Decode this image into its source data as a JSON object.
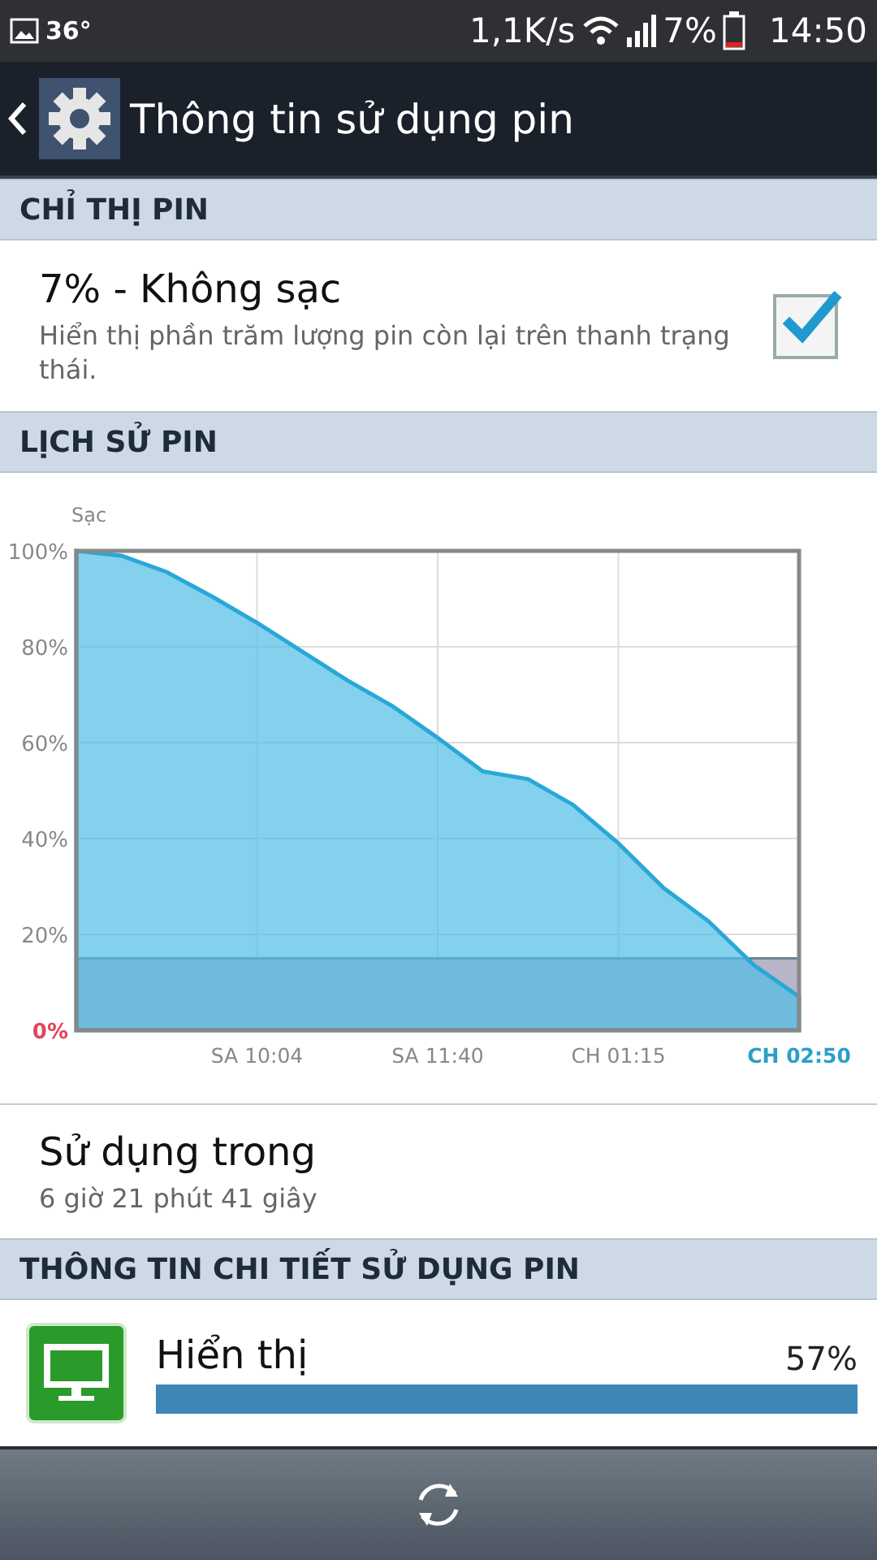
{
  "status_bar": {
    "temperature": "36°",
    "speed": "1,1K/s",
    "battery": "7%",
    "time": "14:50"
  },
  "action_bar": {
    "title": "Thông tin sử dụng pin"
  },
  "sections": [
    {
      "kind": "checkbox",
      "header": "CHỈ THỊ PIN",
      "title": "7% - Không sạc",
      "summary": "Hiển thị phần trăm lượng pin còn lại trên thanh trạng thái.",
      "checked": true
    },
    {
      "kind": "chart",
      "header": "LỊCH SỬ PIN",
      "chart_data": {
        "type": "area",
        "ylabel": "Sạc",
        "categories": [
          null,
          null,
          null,
          null,
          "SA 10:04",
          null,
          null,
          null,
          "SA 11:40",
          null,
          null,
          null,
          "CH 01:15",
          null,
          null,
          null,
          "CH 02:50"
        ],
        "series": [
          {
            "color": "#29a8d8",
            "values": [
              100,
              99,
              95.6,
              90.5,
              85,
              79,
              73,
              67.6,
              61,
              54,
              52.4,
              47,
              39,
              29.7,
              22.7,
              13.6,
              7
            ]
          }
        ],
        "ylim": [
          0,
          100
        ],
        "yticks": [
          {
            "value": 0,
            "label": "0%"
          },
          {
            "value": 20,
            "label": "20%"
          },
          {
            "value": 40,
            "label": "40%"
          },
          {
            "value": 60,
            "label": "60%"
          },
          {
            "value": 80,
            "label": "80%"
          },
          {
            "value": 100,
            "label": "100%"
          }
        ],
        "grid": true,
        "bands": [
          {
            "axis": "y",
            "from": 0,
            "to": 15
          }
        ]
      },
      "usage_title": "Sử dụng trong",
      "usage_time": "6 giờ 21 phút 41 giây"
    },
    {
      "kind": "usage",
      "header": "THÔNG TIN CHI TIẾT SỬ DỤNG PIN",
      "items": [
        {
          "name": "Hiển thị",
          "percent": "57%",
          "level": 1
        }
      ]
    }
  ]
}
